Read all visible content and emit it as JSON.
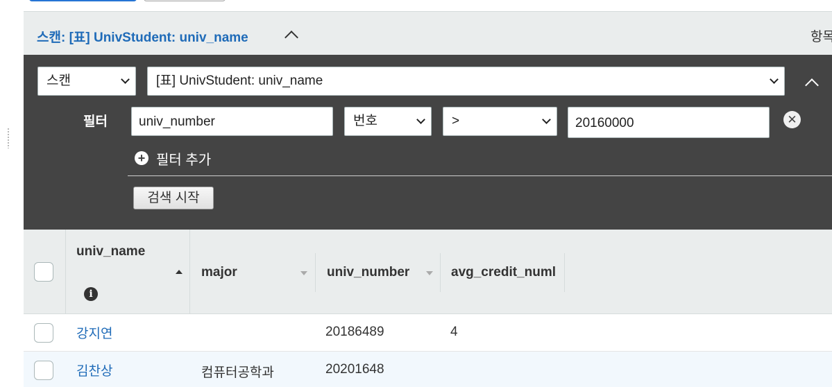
{
  "scan_header": {
    "title": "스캔: [표] UnivStudent: univ_name",
    "items_label": "항목"
  },
  "filter_panel": {
    "operation_select": "스캔",
    "target_select": "[표] UnivStudent: univ_name",
    "filter": {
      "label": "필터",
      "attribute": "univ_number",
      "type_select": "번호",
      "condition_select": ">",
      "value": "20160000"
    },
    "add_filter_label": "필터 추가",
    "start_search_label": "검색 시작"
  },
  "table": {
    "columns": [
      "univ_name",
      "major",
      "univ_number",
      "avg_credit_numl"
    ],
    "rows": [
      {
        "univ_name": "강지연",
        "major": "",
        "univ_number": "20186489",
        "avg_credit_number": "4"
      },
      {
        "univ_name": "김찬상",
        "major": "컴퓨터공학과",
        "univ_number": "20201648",
        "avg_credit_number": ""
      }
    ]
  },
  "colors": {
    "link": "#1f6bb8",
    "panel_bg": "#444444",
    "header_bg": "#eaeded",
    "selected_row_bg": "#f2f8fd"
  },
  "icons": {
    "header_toggle": "chevron-up-icon",
    "panel_toggle": "chevron-up-icon",
    "remove_filter": "close-circle-icon",
    "add_filter": "plus-circle-icon",
    "column_info": "info-icon",
    "sort_ascending": "sort-up-icon",
    "sort_inactive": "sort-down-icon"
  }
}
